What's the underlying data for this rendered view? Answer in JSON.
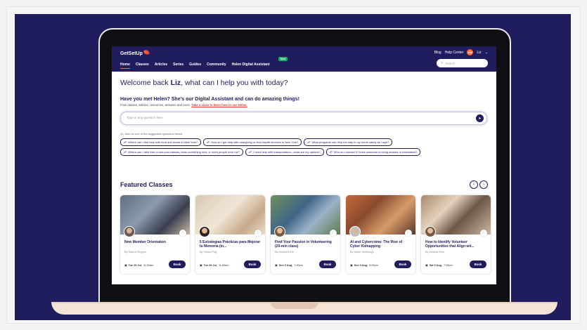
{
  "colors": {
    "brand_navy": "#1f1d5e",
    "accent_orange": "#ff6b3d",
    "new_green": "#23a86b"
  },
  "nav": {
    "logo": "GetSetUp",
    "menu": [
      "Home",
      "Classes",
      "Articles",
      "Series",
      "Guides",
      "Community",
      "Helen Digital Assistant"
    ],
    "new_badge": "New",
    "blog": "Blog",
    "help": "Help Center",
    "avatar_initials": "LW",
    "user": "Liz",
    "search_placeholder": "Search"
  },
  "welcome": {
    "prefix": "Welcome back ",
    "name": "Liz",
    "suffix": ", what can I help you with today?"
  },
  "helen": {
    "title": "Have you met Helen? She's our Digital Assistant and can do amazing things!",
    "subtitle": "Find classes, articles, resources, answers and more.",
    "link": "Take a class to learn how to use Helen.",
    "input_placeholder": "Type in any question here",
    "or_click": "Or, click on one of the suggested questions below."
  },
  "suggestions": [
    "Where can I find help with food and meals in New York?",
    "How do I get help with caregiving or find respite services in New York?",
    "What programs can help me stay in my home safely as I age?",
    "Where can I take free or low-cost classes, learn something new, or meet people near me?",
    "I need help with transportation—what are my options?",
    "Who do I contact if I think someone is being abused or mistreated?"
  ],
  "featured": {
    "title": "Featured Classes",
    "classes": [
      {
        "title": "New Member Orientation",
        "by": "By Sharon Rogers",
        "date": "Tue 29 Jul,",
        "time": "11:00am",
        "book": "Book"
      },
      {
        "title": "5 Estrategias Prácticas para Mejorar tu Memoria (in...",
        "by": "By Yesica Pug",
        "date": "Tue 29 Jul,",
        "time": "11:00am",
        "book": "Book"
      },
      {
        "title": "Find Your Passion in Volunteering (20-min class)",
        "by": "By Kristina Kern",
        "date": "Sun 3 Aug,",
        "time": "7:00pm",
        "book": "Book"
      },
      {
        "title": "AI and Cybercrime: The Rise of Cyber Kidnapping",
        "by": "By Wade Yarbrough",
        "date": "Sun 3 Aug,",
        "time": "8:00pm",
        "book": "Book"
      },
      {
        "title": "How to Identify Volunteer Opportunities that Align wit...",
        "by": "By Kristina Kern",
        "date": "Sat 9 Aug,",
        "time": "7:00pm",
        "book": "Book"
      }
    ]
  }
}
